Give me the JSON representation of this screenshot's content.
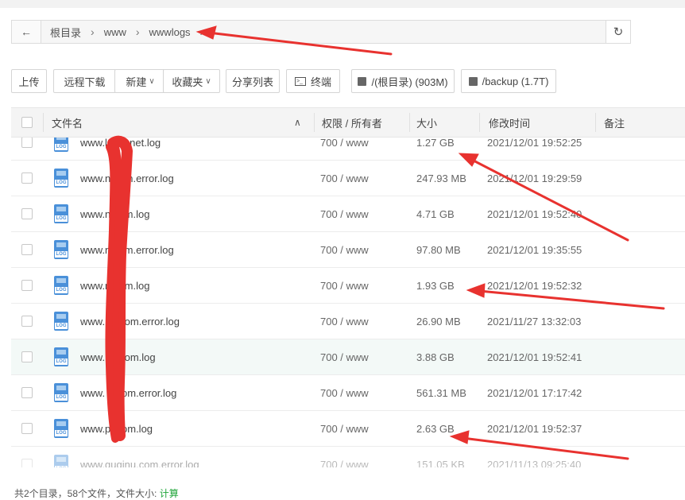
{
  "breadcrumb": {
    "items": [
      "根目录",
      "www",
      "wwwlogs"
    ]
  },
  "toolbar": {
    "upload": "上传",
    "remote_download": "远程下载",
    "new": "新建",
    "favorites": "收藏夹",
    "share_list": "分享列表",
    "terminal": "终端",
    "disk_root": "/(根目录) (903M)",
    "disk_backup": "/backup (1.7T)"
  },
  "table": {
    "headers": {
      "name": "文件名",
      "perm": "权限 / 所有者",
      "size": "大小",
      "mtime": "修改时间",
      "note": "备注"
    },
    "rows": [
      {
        "name": "www.l     chu.net.log",
        "perm": "700 / www",
        "size": "1.27 GB",
        "mtime": "2021/12/01 19:52:25"
      },
      {
        "name": "www.n     com.error.log",
        "perm": "700 / www",
        "size": "247.93 MB",
        "mtime": "2021/12/01 19:29:59"
      },
      {
        "name": "www.n     com.log",
        "perm": "700 / www",
        "size": "4.71 GB",
        "mtime": "2021/12/01 19:52:40"
      },
      {
        "name": "www.n     com.error.log",
        "perm": "700 / www",
        "size": "97.80 MB",
        "mtime": "2021/12/01 19:35:55"
      },
      {
        "name": "www.n     com.log",
        "perm": "700 / www",
        "size": "1.93 GB",
        "mtime": "2021/12/01 19:52:32"
      },
      {
        "name": "www.     tu.com.error.log",
        "perm": "700 / www",
        "size": "26.90 MB",
        "mtime": "2021/11/27 13:32:03"
      },
      {
        "name": "www.     tu.com.log",
        "perm": "700 / www",
        "size": "3.88 GB",
        "mtime": "2021/12/01 19:52:41"
      },
      {
        "name": "www.     9.com.error.log",
        "perm": "700 / www",
        "size": "561.31 MB",
        "mtime": "2021/12/01 17:17:42"
      },
      {
        "name": "www.p     .com.log",
        "perm": "700 / www",
        "size": "2.63 GB",
        "mtime": "2021/12/01 19:52:37"
      },
      {
        "name": "www.guqinu.com.error.log",
        "perm": "700 / www",
        "size": "151.05 KB",
        "mtime": "2021/11/13 09:25:40"
      }
    ]
  },
  "footer": {
    "summary": "共2个目录，58个文件，文件大小:",
    "calc": "计算"
  },
  "colors": {
    "annotation": "#e8322f",
    "accent": "#20a53a",
    "file_icon": "#4a90d9"
  }
}
